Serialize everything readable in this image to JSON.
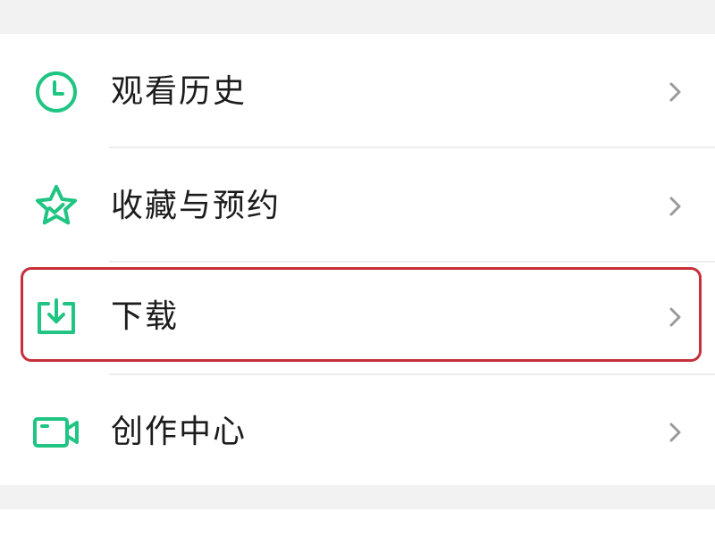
{
  "menu": {
    "items": [
      {
        "label": "观看历史",
        "icon": "clock-icon"
      },
      {
        "label": "收藏与预约",
        "icon": "star-icon"
      },
      {
        "label": "下载",
        "icon": "download-icon"
      },
      {
        "label": "创作中心",
        "icon": "video-camera-icon"
      }
    ]
  },
  "colors": {
    "accent": "#20c483",
    "highlight_border": "#c6303b",
    "text": "#1c1c1c",
    "chevron": "#9a9a9a",
    "background": "#f2f2f2"
  },
  "highlighted_item": "下载"
}
